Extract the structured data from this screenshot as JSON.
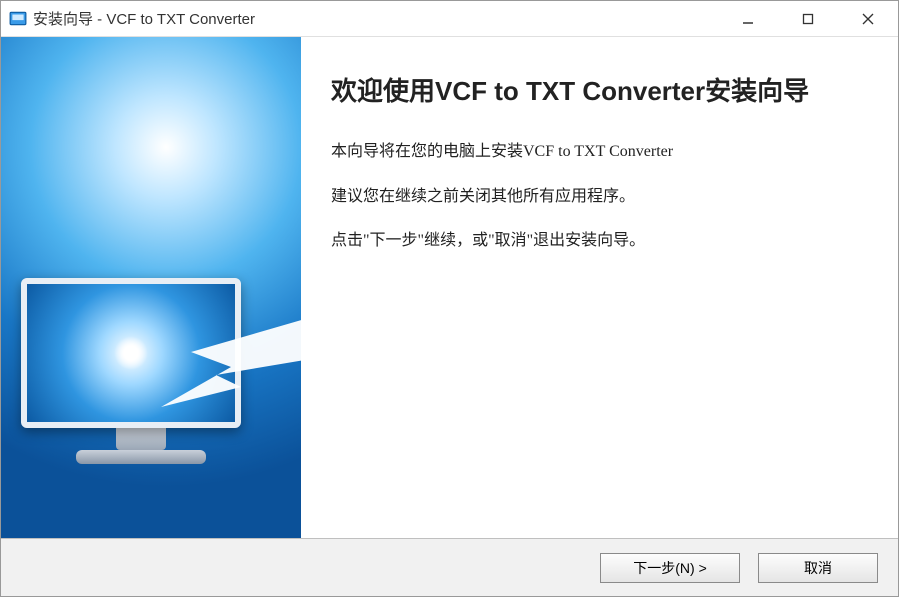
{
  "titlebar": {
    "text": "安装向导 - VCF to TXT Converter"
  },
  "content": {
    "heading": "欢迎使用VCF to TXT Converter安装向导",
    "line1": "本向导将在您的电脑上安装VCF to TXT Converter",
    "line2": "建议您在继续之前关闭其他所有应用程序。",
    "line3": "点击\"下一步\"继续，或\"取消\"退出安装向导。"
  },
  "buttons": {
    "next": "下一步(N) >",
    "cancel": "取消"
  }
}
